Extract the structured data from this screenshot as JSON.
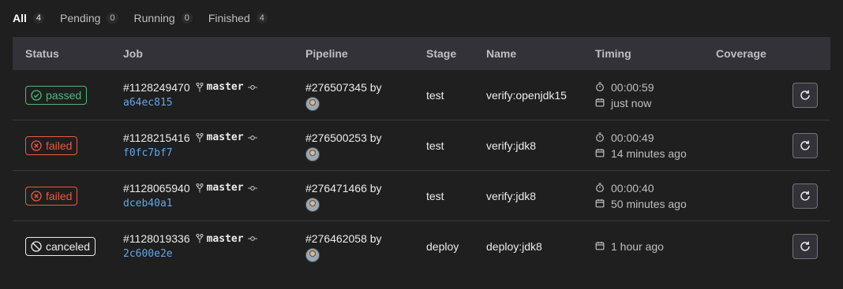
{
  "tabs": [
    {
      "label": "All",
      "count": "4"
    },
    {
      "label": "Pending",
      "count": "0"
    },
    {
      "label": "Running",
      "count": "0"
    },
    {
      "label": "Finished",
      "count": "4"
    }
  ],
  "columns": {
    "status": "Status",
    "job": "Job",
    "pipeline": "Pipeline",
    "stage": "Stage",
    "name": "Name",
    "timing": "Timing",
    "coverage": "Coverage"
  },
  "jobs": [
    {
      "status": "passed",
      "job_id": "#1128249470",
      "branch": "master",
      "sha": "a64ec815",
      "pipeline": "#276507345 by",
      "stage": "test",
      "name": "verify:openjdk15",
      "duration": "00:00:59",
      "finished": "just now"
    },
    {
      "status": "failed",
      "job_id": "#1128215416",
      "branch": "master",
      "sha": "f0fc7bf7",
      "pipeline": "#276500253 by",
      "stage": "test",
      "name": "verify:jdk8",
      "duration": "00:00:49",
      "finished": "14 minutes ago"
    },
    {
      "status": "failed",
      "job_id": "#1128065940",
      "branch": "master",
      "sha": "dceb40a1",
      "pipeline": "#276471466 by",
      "stage": "test",
      "name": "verify:jdk8",
      "duration": "00:00:40",
      "finished": "50 minutes ago"
    },
    {
      "status": "canceled",
      "job_id": "#1128019336",
      "branch": "master",
      "sha": "2c600e2e",
      "pipeline": "#276462058 by",
      "stage": "deploy",
      "name": "deploy:jdk8",
      "finished": "1 hour ago"
    }
  ],
  "colors": {
    "passed": "#52b87a",
    "failed": "#ec5941",
    "canceled": "#ececef",
    "link": "#63a6e9"
  },
  "icons": {
    "branch": "branch-icon",
    "commit": "commit-icon",
    "timer": "timer-icon",
    "calendar": "calendar-icon",
    "retry": "retry-icon"
  }
}
